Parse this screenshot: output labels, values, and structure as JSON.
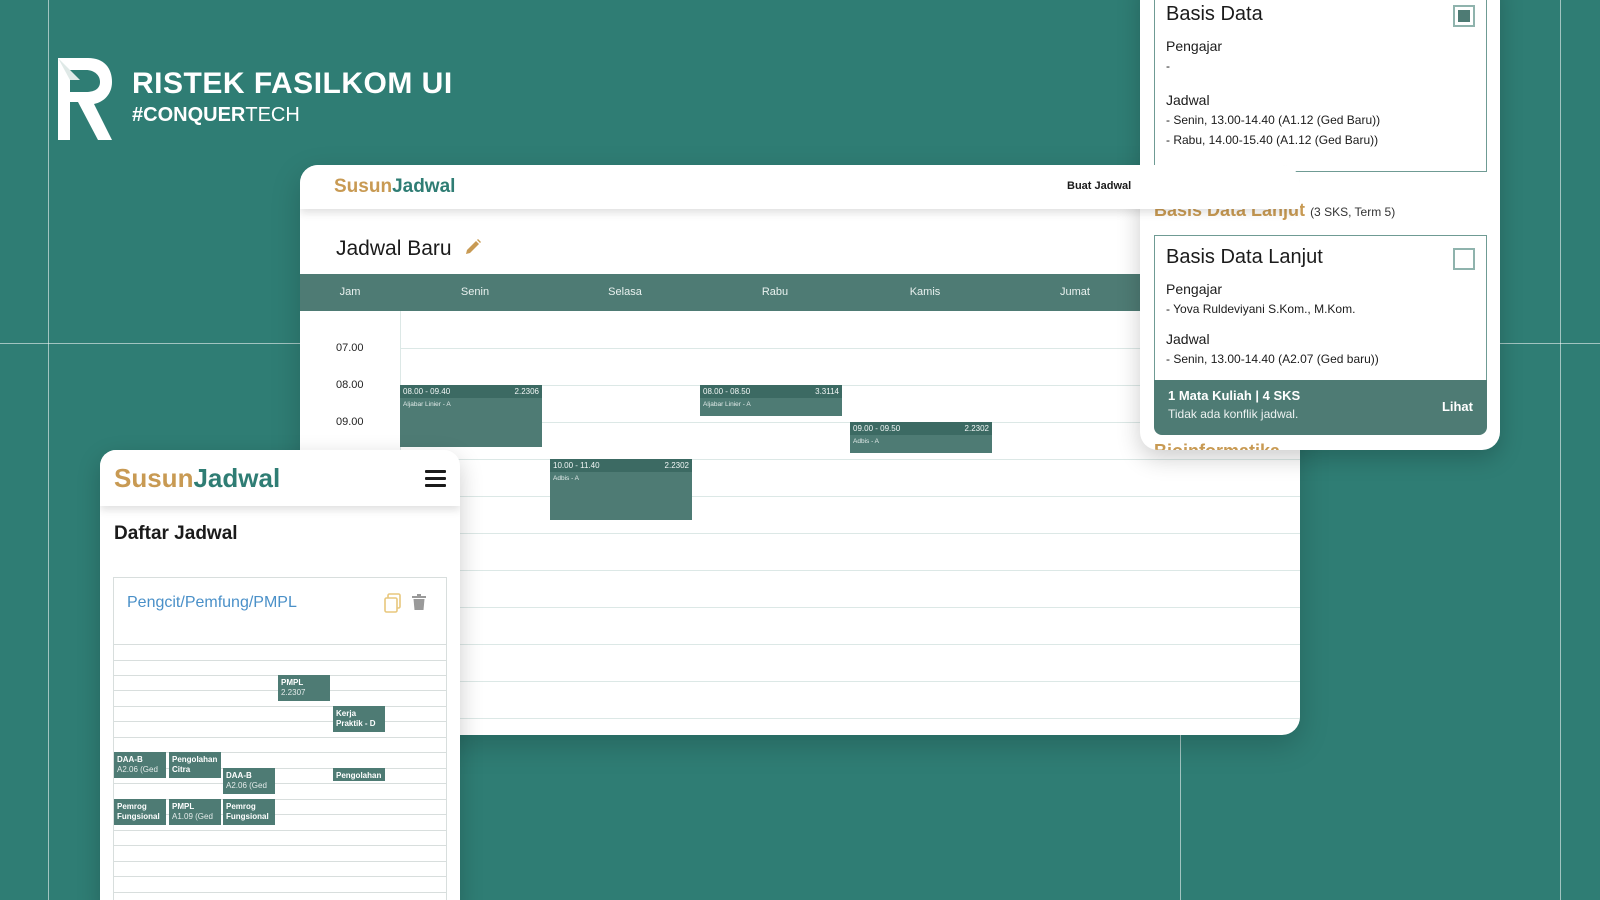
{
  "brand": {
    "title": "RISTEK FASILKOM UI",
    "tag_bold": "#CONQUER",
    "tag_rest": "TECH"
  },
  "desktop": {
    "logo": {
      "part1": "Susun",
      "part2": "Jadwal"
    },
    "nav_link": "Buat Jadwal",
    "title": "Jadwal Baru",
    "days": [
      "Jam",
      "Senin",
      "Selasa",
      "Rabu",
      "Kamis",
      "Jumat"
    ],
    "times": [
      "07.00",
      "08.00",
      "09.00"
    ],
    "events": [
      {
        "time": "08.00 - 09.40",
        "room": "2.2306",
        "name": "Aljabar Linier - A"
      },
      {
        "time": "08.00 - 08.50",
        "room": "3.3114",
        "name": "Aljabar Linier - A"
      },
      {
        "time": "09.00 - 09.50",
        "room": "2.2302",
        "name": "Adbis - A"
      },
      {
        "time": "10.00 - 11.40",
        "room": "2.2302",
        "name": "Adbis - A"
      }
    ]
  },
  "mobile": {
    "logo": {
      "part1": "Susun",
      "part2": "Jadwal"
    },
    "title": "Daftar Jadwal",
    "card_title": "Pengcit/Pemfung/PMPL",
    "events": [
      {
        "name": "PMPL",
        "room": "2.2307"
      },
      {
        "name": "Kerja Praktik - D",
        "room": ""
      },
      {
        "name": "DAA-B",
        "room": "A2.06 (Ged"
      },
      {
        "name": "Pengolahan Citra",
        "room": ""
      },
      {
        "name": "DAA-B",
        "room": "A2.06 (Ged"
      },
      {
        "name": "Pengolahan",
        "room": ""
      },
      {
        "name": "Pemrog Fungsional",
        "room": ""
      },
      {
        "name": "PMPL",
        "room": "A1.09 (Ged"
      },
      {
        "name": "Pemrog Fungsional",
        "room": ""
      }
    ]
  },
  "panel": {
    "card1": {
      "title": "Basis Data",
      "checked": true,
      "pengajar_label": "Pengajar",
      "pengajar": "-",
      "jadwal_label": "Jadwal",
      "jadwal": [
        "- Senin, 13.00-14.40 (A1.12 (Ged Baru))",
        "- Rabu, 14.00-15.40 (A1.12 (Ged Baru))"
      ]
    },
    "course_heading": "Basis Data Lanjut",
    "course_meta": "(3 SKS, Term 5)",
    "card2": {
      "title": "Basis Data Lanjut",
      "checked": false,
      "pengajar_label": "Pengajar",
      "pengajar": "- Yova Ruldeviyani S.Kom., M.Kom.",
      "jadwal_label": "Jadwal",
      "jadwal": [
        "- Senin, 13.00-14.40 (A2.07 (Ged baru))"
      ]
    },
    "summary": {
      "line1": "1 Mata Kuliah | 4 SKS",
      "line2": "Tidak ada konflik jadwal.",
      "action": "Lihat"
    },
    "next_heading": "Bioinformatika"
  },
  "colors": {
    "background": "#2f7d74",
    "primary": "#4e7b74",
    "gold": "#c89a53",
    "link": "#4a90c8"
  }
}
